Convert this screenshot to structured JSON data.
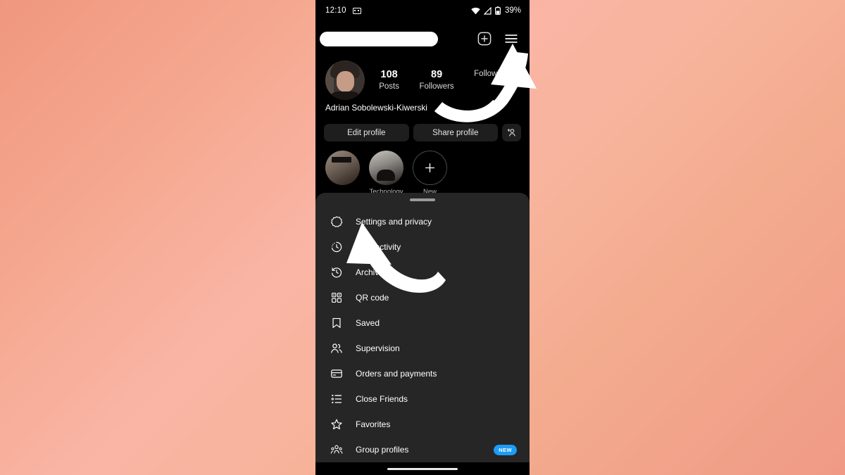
{
  "status_bar": {
    "time": "12:10",
    "battery_percent": "39%",
    "icons": [
      "notification-icon",
      "wifi-icon",
      "signal-icon",
      "battery-icon"
    ]
  },
  "header": {
    "username_redacted": "",
    "add_icon": "plus-square-icon",
    "menu_icon": "hamburger-menu-icon"
  },
  "profile": {
    "display_name": "Adrian Sobolewski-Kiwerski",
    "stats": [
      {
        "value": "108",
        "label": "Posts"
      },
      {
        "value": "89",
        "label": "Followers"
      },
      {
        "value": "",
        "label": "Following"
      }
    ],
    "actions": {
      "edit": "Edit profile",
      "share": "Share profile",
      "add_person_icon": "add-person-icon"
    }
  },
  "highlights": [
    {
      "label": "",
      "type": "story"
    },
    {
      "label": "Technology",
      "type": "story"
    },
    {
      "label": "New",
      "type": "add"
    }
  ],
  "sheet": {
    "items": [
      {
        "label": "Settings and privacy",
        "icon": "gear-icon",
        "badge": ""
      },
      {
        "label": "Your activity",
        "icon": "activity-clock-icon",
        "badge": ""
      },
      {
        "label": "Archive",
        "icon": "archive-history-icon",
        "badge": ""
      },
      {
        "label": "QR code",
        "icon": "qr-code-icon",
        "badge": ""
      },
      {
        "label": "Saved",
        "icon": "bookmark-icon",
        "badge": ""
      },
      {
        "label": "Supervision",
        "icon": "supervision-people-icon",
        "badge": ""
      },
      {
        "label": "Orders and payments",
        "icon": "credit-card-icon",
        "badge": ""
      },
      {
        "label": "Close Friends",
        "icon": "list-icon",
        "badge": ""
      },
      {
        "label": "Favorites",
        "icon": "star-icon",
        "badge": ""
      },
      {
        "label": "Group profiles",
        "icon": "group-profiles-icon",
        "badge": "NEW"
      }
    ]
  },
  "annotations": {
    "arrows": [
      {
        "name": "arrow-to-hamburger-menu"
      },
      {
        "name": "arrow-to-settings-and-privacy"
      }
    ]
  },
  "colors": {
    "badge_blue": "#1c9cf6",
    "sheet_bg": "#262626",
    "phone_bg": "#000000",
    "backdrop_from": "#f0977f",
    "backdrop_to": "#f6ce94"
  }
}
